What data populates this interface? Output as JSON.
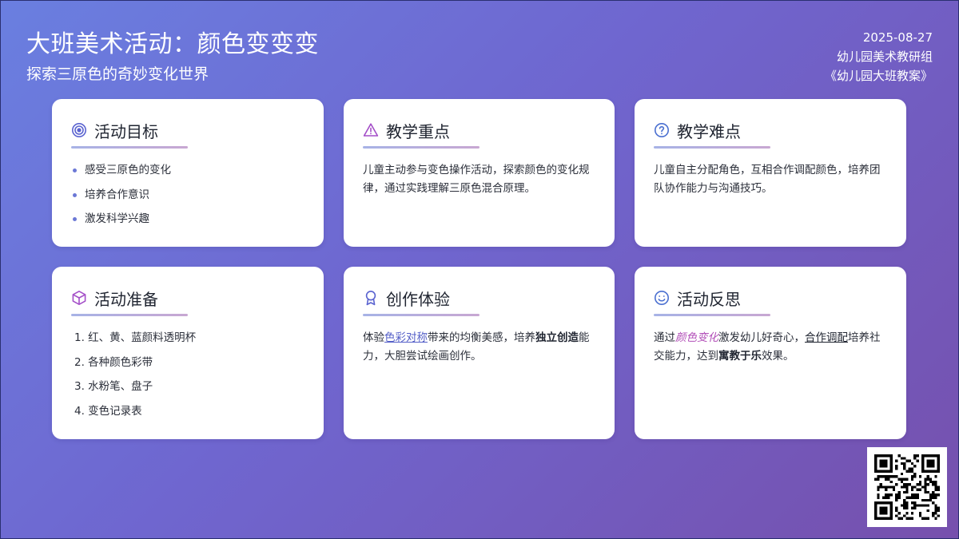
{
  "header": {
    "title": "大班美术活动：颜色变变变",
    "subtitle": "探索三原色的奇妙变化世界",
    "date": "2025-08-27",
    "author": "幼儿园美术教研组",
    "source": "《幼儿园大班教案》"
  },
  "cards": {
    "goals": {
      "icon": "target-icon",
      "title": "活动目标",
      "items": [
        "感受三原色的变化",
        "培养合作意识",
        "激发科学兴趣"
      ]
    },
    "key_points": {
      "icon": "warning-triangle-icon",
      "title": "教学重点",
      "text": "儿童主动参与变色操作活动，探索颜色的变化规律，通过实践理解三原色混合原理。"
    },
    "difficulties": {
      "icon": "question-circle-icon",
      "title": "教学难点",
      "text": "儿童自主分配角色，互相合作调配颜色，培养团队协作能力与沟通技巧。"
    },
    "preparation": {
      "icon": "cube-icon",
      "title": "活动准备",
      "items": [
        "1. 红、黄、蓝颜料透明杯",
        "2. 各种颜色彩带",
        "3. 水粉笔、盘子",
        "4. 变色记录表"
      ]
    },
    "experience": {
      "icon": "award-ribbon-icon",
      "title": "创作体验",
      "text_a": "体验",
      "link": "色彩对称",
      "text_b": "带来的均衡美感，培养",
      "bold": "独立创造",
      "text_c": "能力，大胆尝试绘画创作。"
    },
    "reflection": {
      "icon": "smile-face-icon",
      "title": "活动反思",
      "text_a": "通过",
      "italic": "颜色变化",
      "text_b": "激发幼儿好奇心，",
      "underline": "合作调配",
      "text_c": "培养社交能力，达到",
      "bold": "寓教于乐",
      "text_d": "效果。"
    }
  },
  "colors": {
    "bg_start": "#6a7fe0",
    "bg_end": "#7650ad",
    "icon_blue": "#5a63d0",
    "icon_purple": "#a44fc8",
    "link_blue": "#5560c8",
    "italic_purple": "#b24fb8"
  }
}
